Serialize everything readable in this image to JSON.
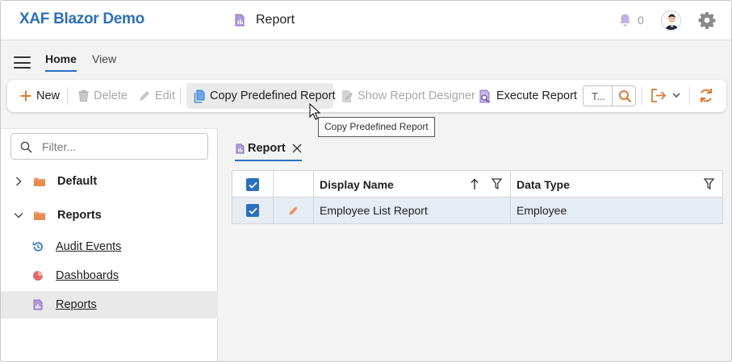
{
  "app": {
    "title": "XAF Blazor Demo"
  },
  "header": {
    "page_title": "Report",
    "notification_count": "0"
  },
  "nav_tabs": {
    "home": "Home",
    "view": "View"
  },
  "toolbar": {
    "new_label": "New",
    "delete_label": "Delete",
    "edit_label": "Edit",
    "copy_label": "Copy Predefined Report",
    "show_designer_label": "Show Report Designer",
    "execute_label": "Execute Report",
    "search_text": "T..."
  },
  "tooltip": {
    "text": "Copy Predefined Report"
  },
  "sidebar": {
    "filter_placeholder": "Filter...",
    "items": [
      {
        "label": "Default",
        "type": "group",
        "expanded": false
      },
      {
        "label": "Reports",
        "type": "group",
        "expanded": true
      },
      {
        "label": "Audit Events",
        "type": "item"
      },
      {
        "label": "Dashboards",
        "type": "item"
      },
      {
        "label": "Reports",
        "type": "item",
        "selected": true
      }
    ]
  },
  "document_tab": {
    "label": "Report"
  },
  "grid": {
    "columns": [
      "Display Name",
      "Data Type"
    ],
    "sort": "ascending",
    "rows": [
      {
        "display_name": "Employee List Report",
        "data_type": "Employee",
        "selected": true
      }
    ]
  },
  "colors": {
    "accent": "#2a6fc0",
    "orange": "#e07a2e",
    "selected_row": "#e6ecf4"
  }
}
